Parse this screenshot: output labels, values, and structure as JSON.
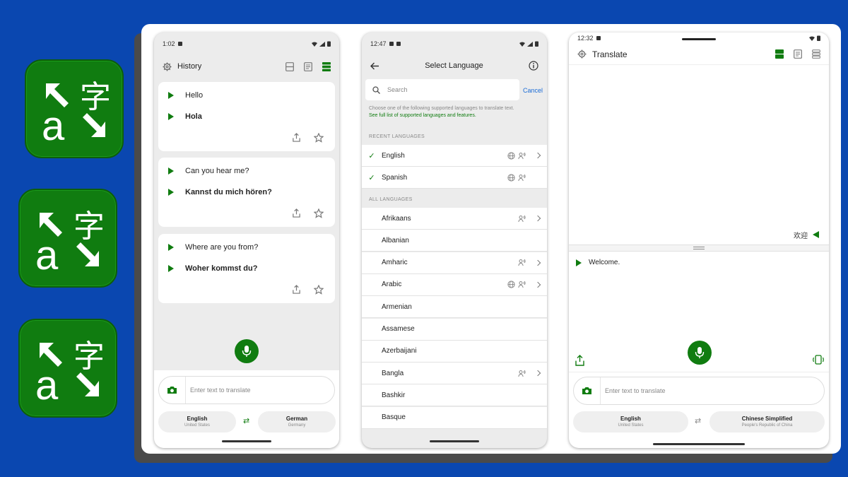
{
  "colors": {
    "brand_green": "#107c10",
    "background_blue": "#0a47b0",
    "link_blue": "#1a6bd6"
  },
  "logos": [
    {
      "glyph_latin": "a",
      "glyph_cjk": "字"
    },
    {
      "glyph_latin": "a",
      "glyph_cjk": "字"
    },
    {
      "glyph_latin": "a",
      "glyph_cjk": "字"
    }
  ],
  "history_screen": {
    "status_time": "1:02",
    "title": "History",
    "items": [
      {
        "source": "Hello",
        "target": "Hola"
      },
      {
        "source": "Can you hear me?",
        "target": "Kannst du mich hören?"
      },
      {
        "source": "Where are you from?",
        "target": "Woher kommst du?"
      }
    ],
    "input_placeholder": "Enter text to translate",
    "from_lang": {
      "name": "English",
      "region": "United States"
    },
    "to_lang": {
      "name": "German",
      "region": "Germany"
    },
    "swap_icon": "⇄"
  },
  "select_screen": {
    "status_time": "12:47",
    "title": "Select Language",
    "search_placeholder": "Search",
    "cancel": "Cancel",
    "hint": "Choose one of the following supported languages to translate text.",
    "hint_link": "See full list of supported languages and features.",
    "recent_header": "RECENT LANGUAGES",
    "all_header": "ALL LANGUAGES",
    "recent": [
      {
        "name": "English",
        "check": "✓",
        "features": [
          "globe-icon",
          "voice-icon"
        ],
        "chevron": true
      },
      {
        "name": "Spanish",
        "check": "✓",
        "features": [
          "globe-icon",
          "voice-icon"
        ],
        "chevron": false
      }
    ],
    "all": [
      {
        "name": "Afrikaans",
        "features": [
          "voice-icon"
        ],
        "chevron": true
      },
      {
        "name": "Albanian",
        "features": [],
        "chevron": false
      },
      {
        "name": "Amharic",
        "features": [
          "voice-icon"
        ],
        "chevron": true
      },
      {
        "name": "Arabic",
        "features": [
          "globe-icon",
          "voice-icon"
        ],
        "chevron": true
      },
      {
        "name": "Armenian",
        "features": [],
        "chevron": false
      },
      {
        "name": "Assamese",
        "features": [],
        "chevron": false
      },
      {
        "name": "Azerbaijani",
        "features": [],
        "chevron": false
      },
      {
        "name": "Bangla",
        "features": [
          "voice-icon"
        ],
        "chevron": true
      },
      {
        "name": "Bashkir",
        "features": [],
        "chevron": false
      },
      {
        "name": "Basque",
        "features": [],
        "chevron": false
      }
    ]
  },
  "translate_screen": {
    "status_time": "12:32",
    "title": "Translate",
    "translated_text": "欢迎",
    "source_text": "Welcome.",
    "input_placeholder": "Enter text to translate",
    "from_lang": {
      "name": "English",
      "region": "United States"
    },
    "to_lang": {
      "name": "Chinese Simplified",
      "region": "People's Republic of China"
    },
    "swap_icon": "⇄"
  }
}
